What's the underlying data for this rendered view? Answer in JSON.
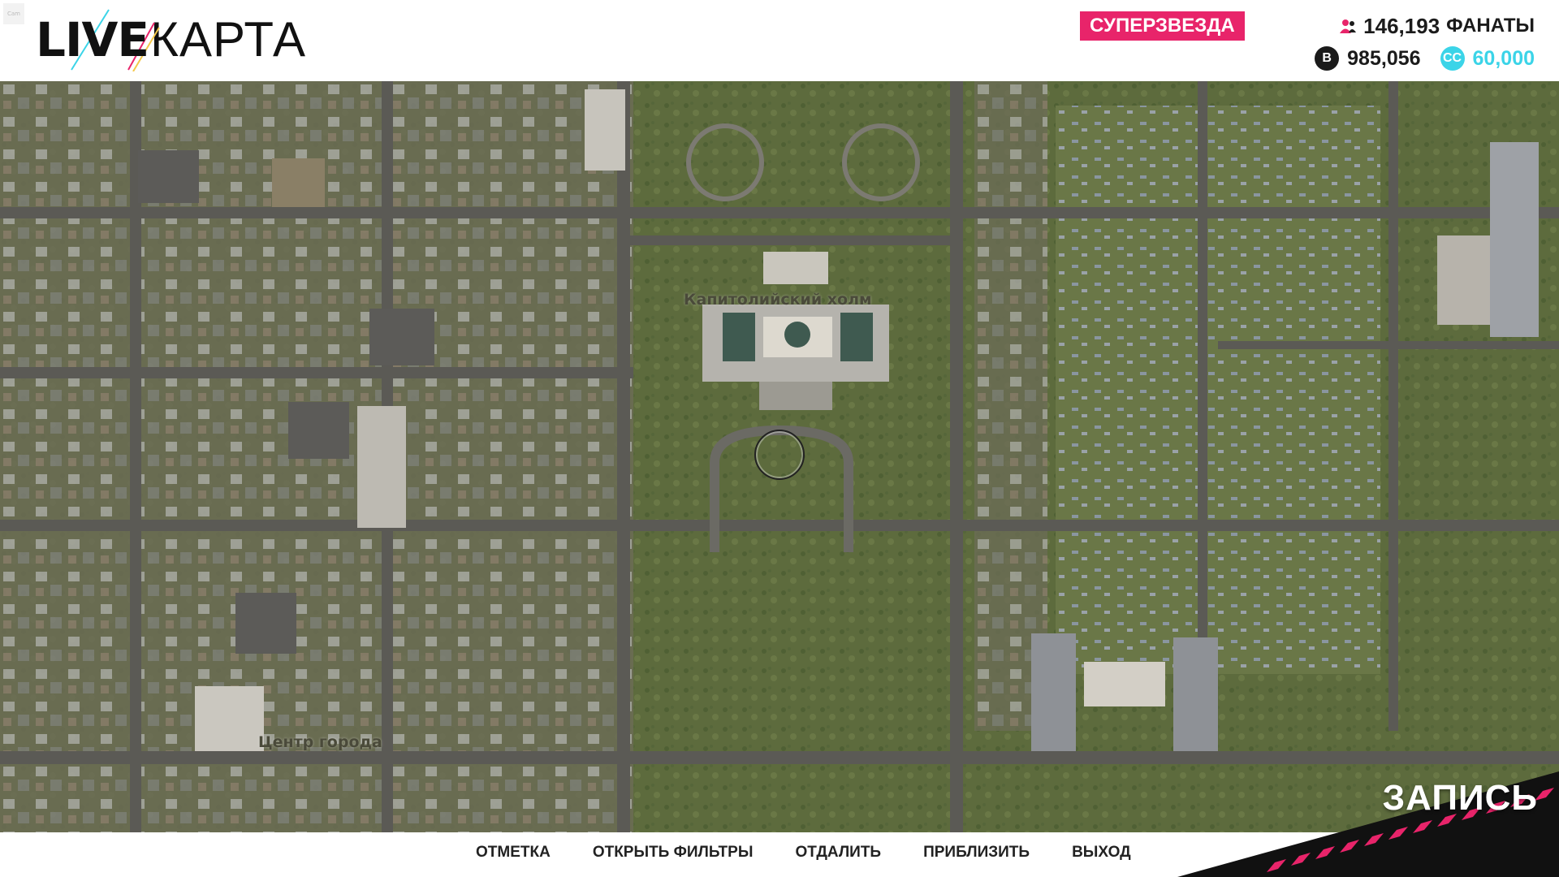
{
  "header": {
    "cam_tag": "Cam",
    "logo": {
      "part1": "LIVE",
      "part2": "КАРТА"
    },
    "rank": "СУПЕРЗВЕЗДА",
    "fans_count": "146,193",
    "fans_label": "ФАНАТЫ",
    "money_icon": "B",
    "money": "985,056",
    "premium_icon": "CC",
    "premium": "60,000"
  },
  "map": {
    "labels": {
      "capitol": "Капитолийский холм",
      "downtown": "Центр города"
    }
  },
  "actions": [
    "ОТМЕТКА",
    "ОТКРЫТЬ ФИЛЬТРЫ",
    "ОТДАЛИТЬ",
    "ПРИБЛИЗИТЬ",
    "ВЫХОД"
  ],
  "record": {
    "label": "ЗАПИСЬ"
  },
  "colors": {
    "accent": "#e8246a",
    "premium": "#3bd4e8",
    "dark": "#1a1a1a"
  }
}
